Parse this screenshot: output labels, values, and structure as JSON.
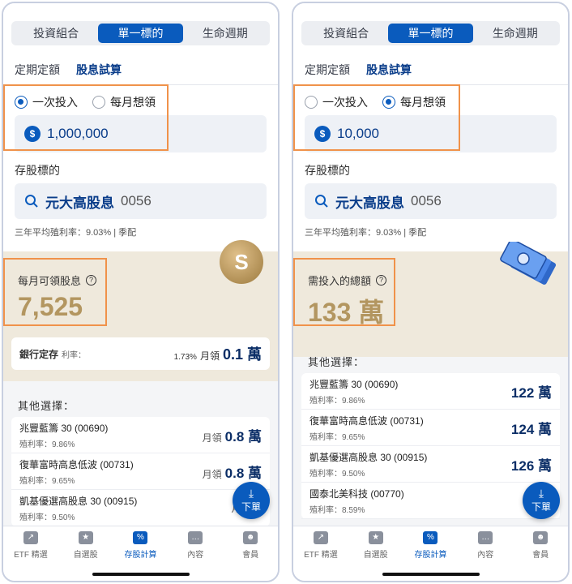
{
  "tabs": [
    "投資組合",
    "單一標的",
    "生命週期"
  ],
  "subtabs": [
    "定期定額",
    "股息試算"
  ],
  "options": [
    "一次投入",
    "每月想領"
  ],
  "currency_icon": "$",
  "stock_label": "存股標的",
  "stock_name": "元大高股息",
  "stock_code": "0056",
  "yield_text": "三年平均殖利率：9.03% | 季配",
  "others_header": "其他選擇：",
  "nav": [
    "ETF 精選",
    "自選股",
    "存股計算",
    "內容",
    "會員"
  ],
  "fab_label": "下單",
  "left": {
    "amount": "1,000,000",
    "result_label": "每月可領股息",
    "result_value": "7,525",
    "bank_label": "銀行定存",
    "bank_rate_label": "利率：",
    "bank_rate": "1.73%",
    "bank_unit": "月領",
    "bank_value": "0.1 萬",
    "rows": [
      {
        "title": "兆豐藍籌 30 (00690)",
        "yield": "殖利率：9.86%",
        "unit": "月領",
        "value": "0.8 萬"
      },
      {
        "title": "復華富時高息低波 (00731)",
        "yield": "殖利率：9.65%",
        "unit": "月領",
        "value": "0.8 萬"
      },
      {
        "title": "凱基優選高股息 30 (00915)",
        "yield": "殖利率：9.50%",
        "unit": "月領",
        "value": "0"
      }
    ]
  },
  "right": {
    "amount": "10,000",
    "result_label": "需投入的總額",
    "result_value": "133 萬",
    "rows": [
      {
        "title": "兆豐藍籌 30 (00690)",
        "yield": "殖利率：9.86%",
        "value": "122 萬"
      },
      {
        "title": "復華富時高息低波 (00731)",
        "yield": "殖利率：9.65%",
        "value": "124 萬"
      },
      {
        "title": "凱基優選高股息 30 (00915)",
        "yield": "殖利率：9.50%",
        "value": "126 萬"
      },
      {
        "title": "國泰北美科技 (00770)",
        "yield": "殖利率：8.59%",
        "value": "1"
      }
    ]
  }
}
